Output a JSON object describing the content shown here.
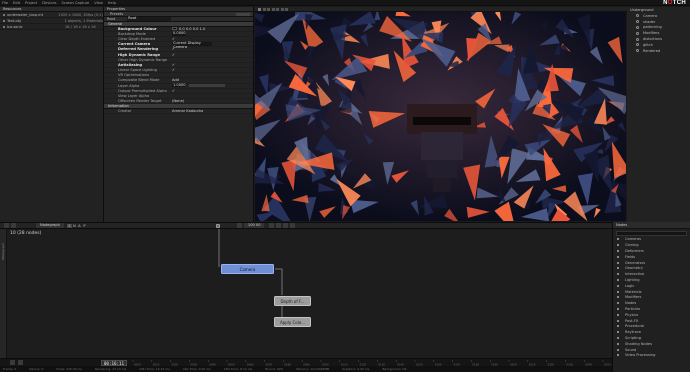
{
  "app": {
    "logo_main": "N",
    "logo_accent": "O",
    "logo_rest": "TCH",
    "menu": [
      "File",
      "Edit",
      "Project",
      "Devices",
      "Screen Capture",
      "View",
      "Help"
    ]
  },
  "resources": {
    "title": "Resources",
    "items": [
      {
        "name": "underwater_loop.mt",
        "info": "1920 x 1080, 30fps (0:1)"
      },
      {
        "name": "Text.obj",
        "info": "1 objects, 1 Materials"
      },
      {
        "name": "Ico.sonic",
        "info": "16 / 16 x 16 x 16"
      }
    ]
  },
  "properties": {
    "title": "Properties",
    "presets_label": "Presets",
    "node_type": "Root",
    "node_name": "Root",
    "section_general": "General",
    "rows": [
      {
        "label": "Background Colour",
        "value": "0.0 0.0 0.0 1.0",
        "kind": "color",
        "bold": true
      },
      {
        "label": "Backdrop Mode",
        "value": "0.0000",
        "kind": "field"
      },
      {
        "label": "Clear Depth Enabled",
        "value": "✓",
        "kind": "check"
      },
      {
        "label": "Current Camera",
        "value": "Current Display Camera",
        "kind": "fieldwide",
        "bold": true
      },
      {
        "label": "Deferred Rendering",
        "value": "✓",
        "kind": "check",
        "bold": true
      },
      {
        "label": "High Dynamic Range",
        "value": "✓",
        "kind": "check",
        "bold": true
      },
      {
        "label": "Other High Dynamic Range",
        "value": "",
        "kind": "check"
      },
      {
        "label": "Antialiasing",
        "value": "✓",
        "kind": "check",
        "bold": true
      },
      {
        "label": "Linear Space Lighting",
        "value": "✓",
        "kind": "check"
      },
      {
        "label": "VR Optimisations",
        "value": "",
        "kind": "check"
      },
      {
        "label": "Composite Blend Mode",
        "value": "Add",
        "kind": "text"
      },
      {
        "label": "Layer Alpha",
        "value": "1.0000",
        "kind": "slider"
      },
      {
        "label": "Output Premultiplied Alpha",
        "value": "✓",
        "kind": "check"
      },
      {
        "label": "View Layer Alpha",
        "value": "",
        "kind": "check"
      },
      {
        "label": "Offscreen Render Target",
        "value": "(None)",
        "kind": "text"
      }
    ],
    "section_information": "Information",
    "creator_label": "Creator",
    "creator_value": "Ammar Kadourka"
  },
  "scene": {
    "root": "Underground",
    "items": [
      "Camera",
      "shader",
      "patterning",
      "Modifiers",
      "distortions",
      "glitch",
      "Rendered"
    ]
  },
  "nodegraph": {
    "tab_label": "Nodegraph",
    "letters": [
      "S",
      "N",
      "A",
      "P"
    ],
    "counter": "10 (28 nodes)",
    "side_label": "Nodegraph",
    "toolbar_value": "100 00",
    "nodes": {
      "camera": "Camera",
      "dof": "Depth of F...",
      "apply": "Apply Colo..."
    }
  },
  "library": {
    "title": "Nodes",
    "items": [
      "Cameras",
      "Cloning",
      "Deformers",
      "Fields",
      "Generators",
      "Geometry",
      "Interactive",
      "Lighting",
      "Logic",
      "Materials",
      "Modifiers",
      "Nodes",
      "Particles",
      "Physics",
      "Post-FX",
      "Procedural",
      "Raytrace",
      "Scripting",
      "Shading Nodes",
      "Sound",
      "Video Processing"
    ]
  },
  "timeline": {
    "timecode": "00:16:11",
    "ticks": [
      "0000",
      "0010",
      "0020",
      "0030",
      "0040",
      "0050",
      "0060",
      "0070",
      "0080",
      "0090",
      "0100",
      "0110",
      "0120",
      "0130",
      "0140",
      "0150",
      "0160",
      "0170",
      "0180",
      "0190",
      "0200",
      "0210",
      "0220",
      "0230",
      "0240",
      "0250"
    ]
  },
  "status": {
    "items": [
      "Frame: 0",
      "Device: 0",
      "Draw: 245.49 ms",
      "Rendering: 27.13 ms",
      "GPU Time: 14.51 ms",
      "Idle Time: 0.00 ms",
      "CPU Time: 8.12 ms",
      "Bound: GPU",
      "Memory: 112/2048MB",
      "Graphics: 0.00 ms",
      "Background: OK"
    ]
  },
  "colors": {
    "accent": "#e0263b",
    "camera_node": "#6e8fd6",
    "viewport_orange": "#ff6a3c",
    "viewport_blue": "#27325e"
  }
}
